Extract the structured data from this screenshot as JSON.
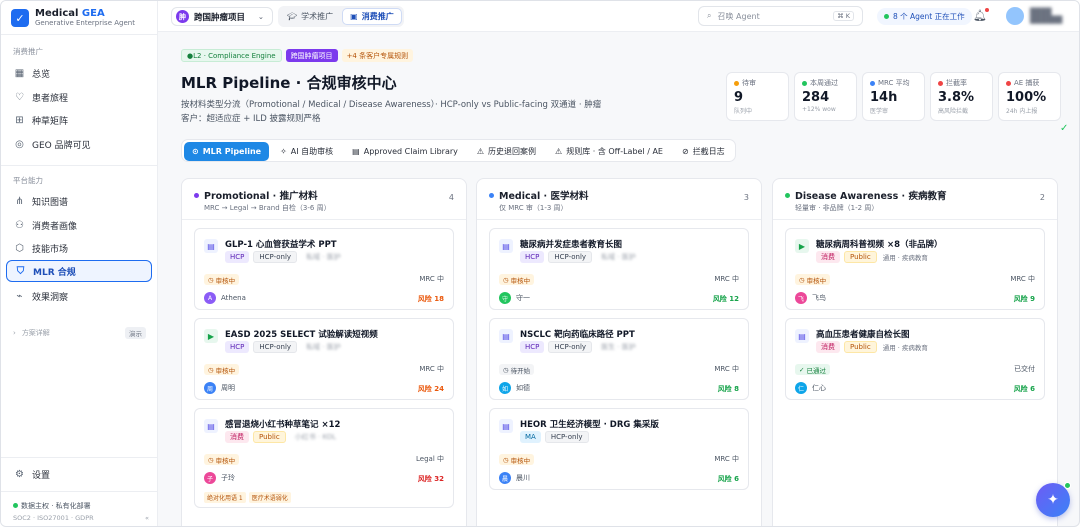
{
  "brand": {
    "name": "Medical",
    "name_accent": "GEA",
    "subtitle": "Generative Enterprise Agent",
    "logo": "check-logo-icon"
  },
  "sidebar": {
    "section1": "消费推广",
    "items1": [
      {
        "label": "总览",
        "icon": "calendar-icon"
      },
      {
        "label": "患者旅程",
        "icon": "heart-pulse-icon"
      },
      {
        "label": "种草矩阵",
        "icon": "grid-icon"
      },
      {
        "label": "GEO 品牌可见",
        "icon": "target-icon"
      }
    ],
    "section2": "平台能力",
    "items2": [
      {
        "label": "知识图谱",
        "icon": "graph-icon"
      },
      {
        "label": "消费者画像",
        "icon": "users-icon"
      },
      {
        "label": "技能市场",
        "icon": "cube-icon"
      },
      {
        "label": "MLR 合规",
        "icon": "shield-icon",
        "active": true
      },
      {
        "label": "效果洞察",
        "icon": "chart-icon"
      }
    ],
    "collapse_label": "方案详解",
    "collapse_tag": "演示",
    "settings": "设置",
    "footer_status": "数据主权 · 私有化部署",
    "footer_cert": "SOC2 · ISO27001 · GDPR"
  },
  "topbar": {
    "project_badge": "肿",
    "project": "跨国肿瘤项目",
    "seg_tabs": [
      {
        "label": "学术推广",
        "active": false
      },
      {
        "label": "消费推广",
        "active": true
      }
    ],
    "search_placeholder": "召唤 Agent",
    "search_kbd": "⌘ K",
    "agents_status": "8 个 Agent 正在工作"
  },
  "page": {
    "pills": [
      "L2 · Compliance Engine",
      "跨国肿瘤项目",
      "+4 条客户专属规则"
    ],
    "title": "MLR Pipeline · 合规审核中心",
    "subtitle1": "按材料类型分流（Promotional / Medical / Disease Awareness）· HCP-only vs Public-facing 双通道 · 肿瘤",
    "subtitle2": "客户：超适应症 + ILD 披露规则严格"
  },
  "stats": [
    {
      "label": "待审",
      "value": "9",
      "hint": "队列中",
      "color": "#f59e0b"
    },
    {
      "label": "本周通过",
      "value": "284",
      "hint": "+12% wow",
      "color": "#22c55e"
    },
    {
      "label": "MRC 平均",
      "value": "14h",
      "hint": "医学审",
      "color": "#3b82f6"
    },
    {
      "label": "拦截率",
      "value": "3.8%",
      "hint": "高风险拦截",
      "color": "#ef4444"
    },
    {
      "label": "AE 捕获",
      "value": "100%",
      "hint": "24h 内上报",
      "color": "#ef4444"
    }
  ],
  "tabs": [
    {
      "label": "MLR Pipeline",
      "icon": "pipeline-icon",
      "active": true
    },
    {
      "label": "AI 自助审核",
      "icon": "sparkle-icon"
    },
    {
      "label": "Approved Claim Library",
      "icon": "book-icon"
    },
    {
      "label": "历史退回案例",
      "icon": "warning-icon"
    },
    {
      "label": "规则库 · 含 Off-Label / AE",
      "icon": "warning-icon"
    },
    {
      "label": "拦截日志",
      "icon": "block-icon"
    }
  ],
  "columns": [
    {
      "title": "Promotional · 推广材料",
      "sub": "MRC → Legal → Brand 自检（3-6 周）",
      "count": "4",
      "dot": "#7c3aed",
      "cards": [
        {
          "icon": "doc-icon",
          "title": "GLP-1 心血管获益学术 PPT",
          "tags": [
            "HCP",
            "HCP-only"
          ],
          "blur": "私域 · 医护",
          "status": "审核中",
          "stage": "MRC 中",
          "person": "Athena",
          "avatar_letter": "A",
          "avatar_color": "#8b5cf6",
          "risk": "风险 18",
          "risk_level": "o"
        },
        {
          "icon": "video-icon",
          "title": "EASD 2025 SELECT 试验解读短视频",
          "tags": [
            "HCP",
            "HCP-only"
          ],
          "blur": "私域 · 医护",
          "status": "审核中",
          "stage": "MRC 中",
          "person": "周明",
          "avatar_letter": "周",
          "avatar_color": "#3b82f6",
          "risk": "风险 24",
          "risk_level": "o"
        },
        {
          "icon": "doc-icon",
          "title": "感冒退烧小红书种草笔记 ×12",
          "tags": [
            "消费",
            "Public"
          ],
          "blur": "小红书 · KOL",
          "status": "审核中",
          "stage": "Legal 中",
          "person": "子玲",
          "avatar_letter": "子",
          "avatar_color": "#ec4899",
          "risk": "风险 32",
          "risk_level": "r",
          "extra": [
            "绝对化用语 1",
            "医疗术语弱化"
          ]
        }
      ]
    },
    {
      "title": "Medical · 医学材料",
      "sub": "仅 MRC 审（1-3 周）",
      "count": "3",
      "dot": "#3b82f6",
      "cards": [
        {
          "icon": "doc-icon",
          "title": "糖尿病并发症患者教育长图",
          "tags": [
            "HCP",
            "HCP-only"
          ],
          "blur": "私域 · 医护",
          "status": "审核中",
          "stage": "MRC 中",
          "person": "守一",
          "avatar_letter": "守",
          "avatar_color": "#22c55e",
          "risk": "风险 12",
          "risk_level": "g"
        },
        {
          "icon": "doc-icon",
          "title": "NSCLC 靶向药临床路径 PPT",
          "tags": [
            "HCP",
            "HCP-only"
          ],
          "blur": "医生 · 医护",
          "status": "待开始",
          "stage": "MRC 中",
          "person": "如德",
          "avatar_letter": "如",
          "avatar_color": "#0ea5e9",
          "risk": "风险 8",
          "risk_level": "g"
        },
        {
          "icon": "doc-icon",
          "title": "HEOR 卫生经济模型 · DRG 集采版",
          "tags": [
            "MA",
            "HCP-only"
          ],
          "blur": "",
          "status": "审核中",
          "stage": "MRC 中",
          "person": "晨川",
          "avatar_letter": "晨",
          "avatar_color": "#3b82f6",
          "risk": "风险 6",
          "risk_level": "g"
        }
      ]
    },
    {
      "title": "Disease Awareness · 疾病教育",
      "sub": "轻量审 · 非品牌（1-2 周）",
      "count": "2",
      "dot": "#22c55e",
      "cards": [
        {
          "icon": "video-icon",
          "title": "糖尿病周科普视频 ×8（非品牌）",
          "tags": [
            "消费",
            "Public"
          ],
          "plain": "通用 · 疾病教育",
          "status": "审核中",
          "stage": "MRC 中",
          "person": "飞鸟",
          "avatar_letter": "飞",
          "avatar_color": "#ec4899",
          "risk": "风险 9",
          "risk_level": "g"
        },
        {
          "icon": "doc-icon",
          "title": "高血压患者健康自检长图",
          "tags": [
            "消费",
            "Public"
          ],
          "plain": "通用 · 疾病教育",
          "status": "已通过",
          "stage": "已交付",
          "person": "仁心",
          "avatar_letter": "仁",
          "avatar_color": "#0ea5e9",
          "risk": "风险 6",
          "risk_level": "g"
        }
      ]
    }
  ]
}
